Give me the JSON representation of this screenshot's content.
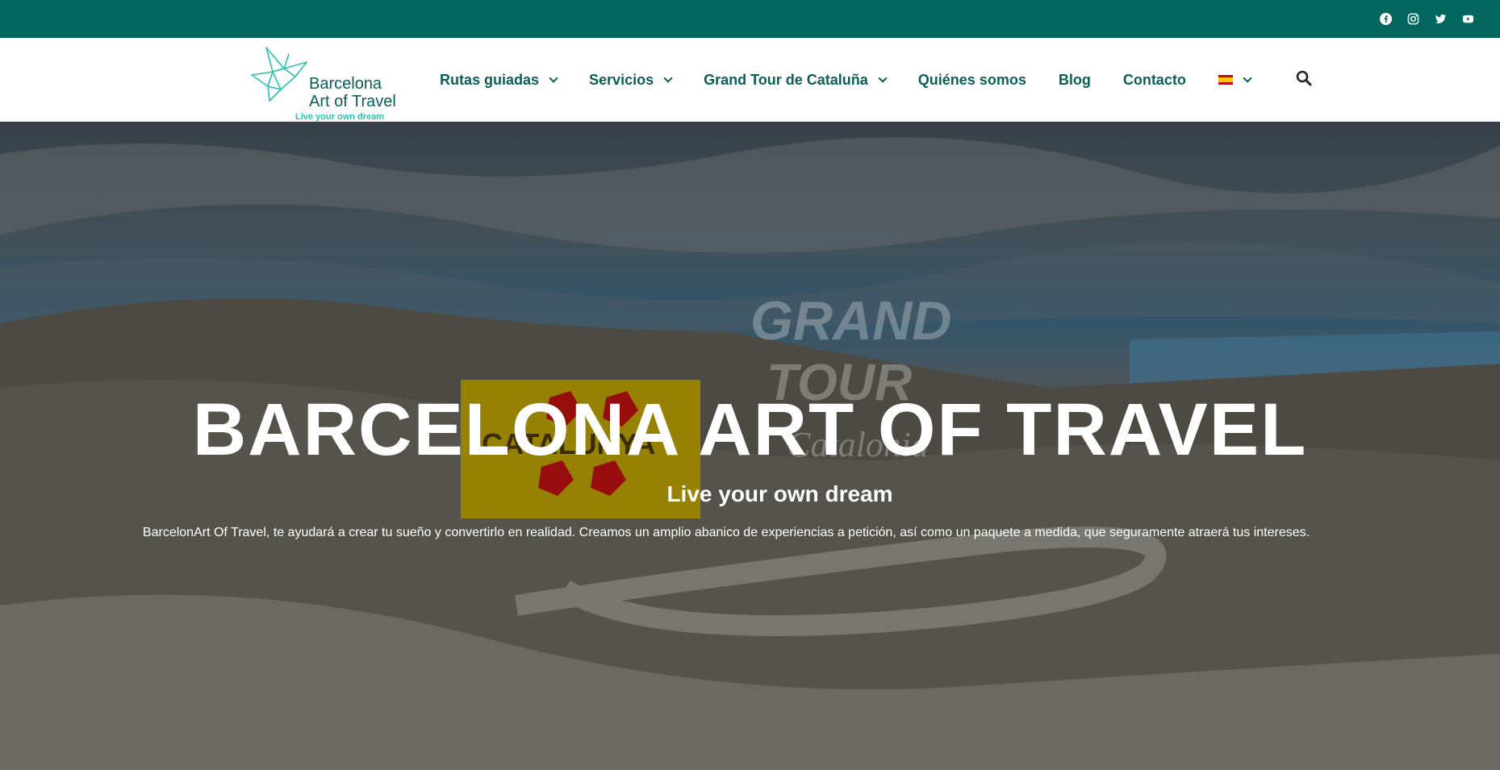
{
  "topbar": {
    "bg_color": "#03665f",
    "social": [
      {
        "icon": "facebook-icon"
      },
      {
        "icon": "instagram-icon"
      },
      {
        "icon": "twitter-icon"
      },
      {
        "icon": "youtube-icon"
      }
    ]
  },
  "header": {
    "logo": {
      "line1": "Barcelona",
      "line2": "Art of Travel",
      "tagline": "Live your own dream"
    },
    "nav": [
      {
        "label": "Rutas guiadas",
        "dropdown": true
      },
      {
        "label": "Servicios",
        "dropdown": true
      },
      {
        "label": "Grand Tour de Cataluña",
        "dropdown": true
      },
      {
        "label": "Quiénes somos",
        "dropdown": false
      },
      {
        "label": "Blog",
        "dropdown": false
      },
      {
        "label": "Contacto",
        "dropdown": false
      }
    ],
    "language": {
      "icon": "spain-flag-icon",
      "dropdown": true
    },
    "search_icon": "search-icon",
    "nav_color": "#0a5e57"
  },
  "hero": {
    "title": "BARCELONA ART OF TRAVEL",
    "subtitle": "Live your own dream",
    "description": "BarcelonArt Of Travel, te ayudará a crear tu sueño y convertirlo en realidad. Creamos un amplio abanico de experiencias a petición, así como un paquete a medida, que seguramente atraerá tus intereses."
  }
}
